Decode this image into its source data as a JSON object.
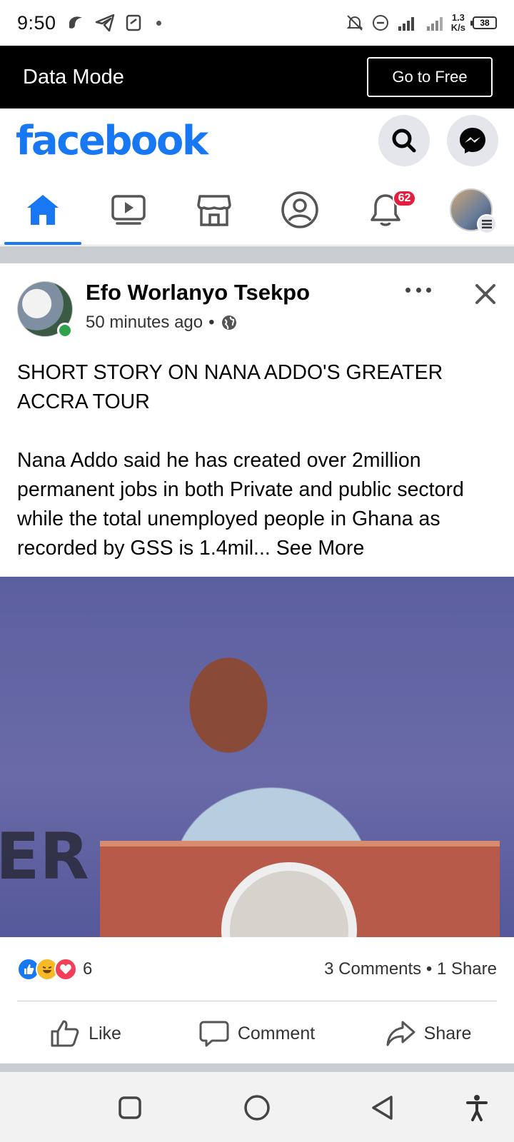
{
  "status_bar": {
    "time": "9:50",
    "net_speed_value": "1.3",
    "net_speed_unit": "K/s",
    "battery": "38"
  },
  "data_mode": {
    "title": "Data Mode",
    "button": "Go to Free"
  },
  "header": {
    "logo": "facebook",
    "search_icon": "search-icon",
    "messenger_icon": "messenger-icon"
  },
  "nav": {
    "tabs": [
      {
        "icon": "home-icon",
        "active": true
      },
      {
        "icon": "video-icon"
      },
      {
        "icon": "marketplace-icon"
      },
      {
        "icon": "profile-icon"
      },
      {
        "icon": "notifications-icon",
        "badge": "62"
      },
      {
        "icon": "menu-avatar"
      }
    ]
  },
  "post": {
    "author": "Efo Worlanyo Tsekpo",
    "time": "50 minutes ago",
    "separator": "•",
    "audience_icon": "globe-icon",
    "text_title": "SHORT STORY ON NANA ADDO'S GREATER ACCRA TOUR",
    "text_body": "Nana Addo said he has created over 2million permanent jobs in both Private and public sectord while the total unemployed people in Ghana as recorded by GSS is 1.4mil...",
    "see_more": "See More",
    "reaction_count": "6",
    "comments": "3 Comments",
    "stats_separator": "•",
    "shares": "1 Share"
  },
  "actions": {
    "like": "Like",
    "comment": "Comment",
    "share": "Share"
  },
  "colors": {
    "brand": "#1877f2",
    "badge": "#e41e3f",
    "online": "#31a24c"
  }
}
